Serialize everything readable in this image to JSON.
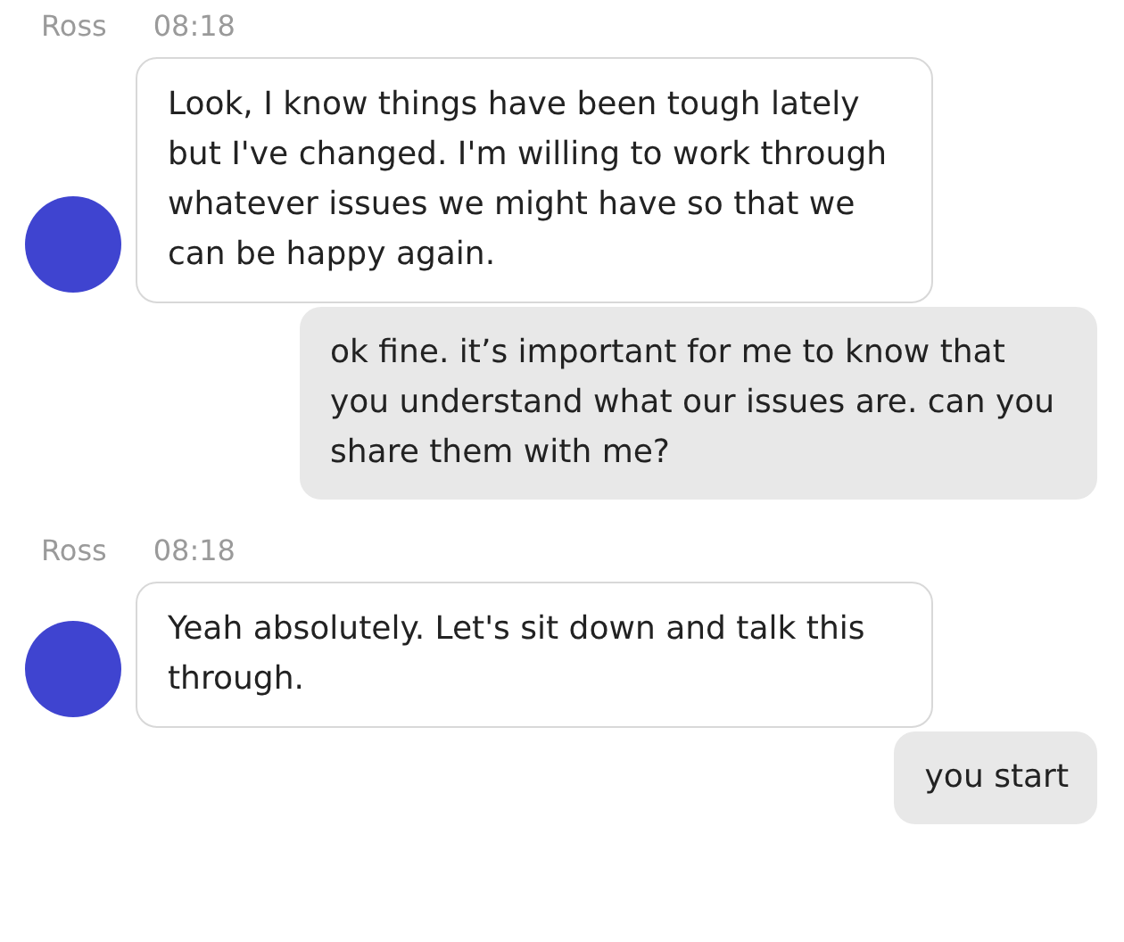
{
  "messages": [
    {
      "kind": "incoming",
      "sender": "Ross",
      "time": "08:18",
      "text": "Look, I know things have been tough lately but I've changed. I'm willing to work through whatever issues we might have so that we can be happy again."
    },
    {
      "kind": "outgoing",
      "text": "ok fine. it’s important for me to know that you understand what our issues are. can you share them with me?"
    },
    {
      "kind": "incoming",
      "sender": "Ross",
      "time": "08:18",
      "text": "Yeah absolutely. Let's sit down and talk this through."
    },
    {
      "kind": "outgoing",
      "text": "you start"
    }
  ]
}
